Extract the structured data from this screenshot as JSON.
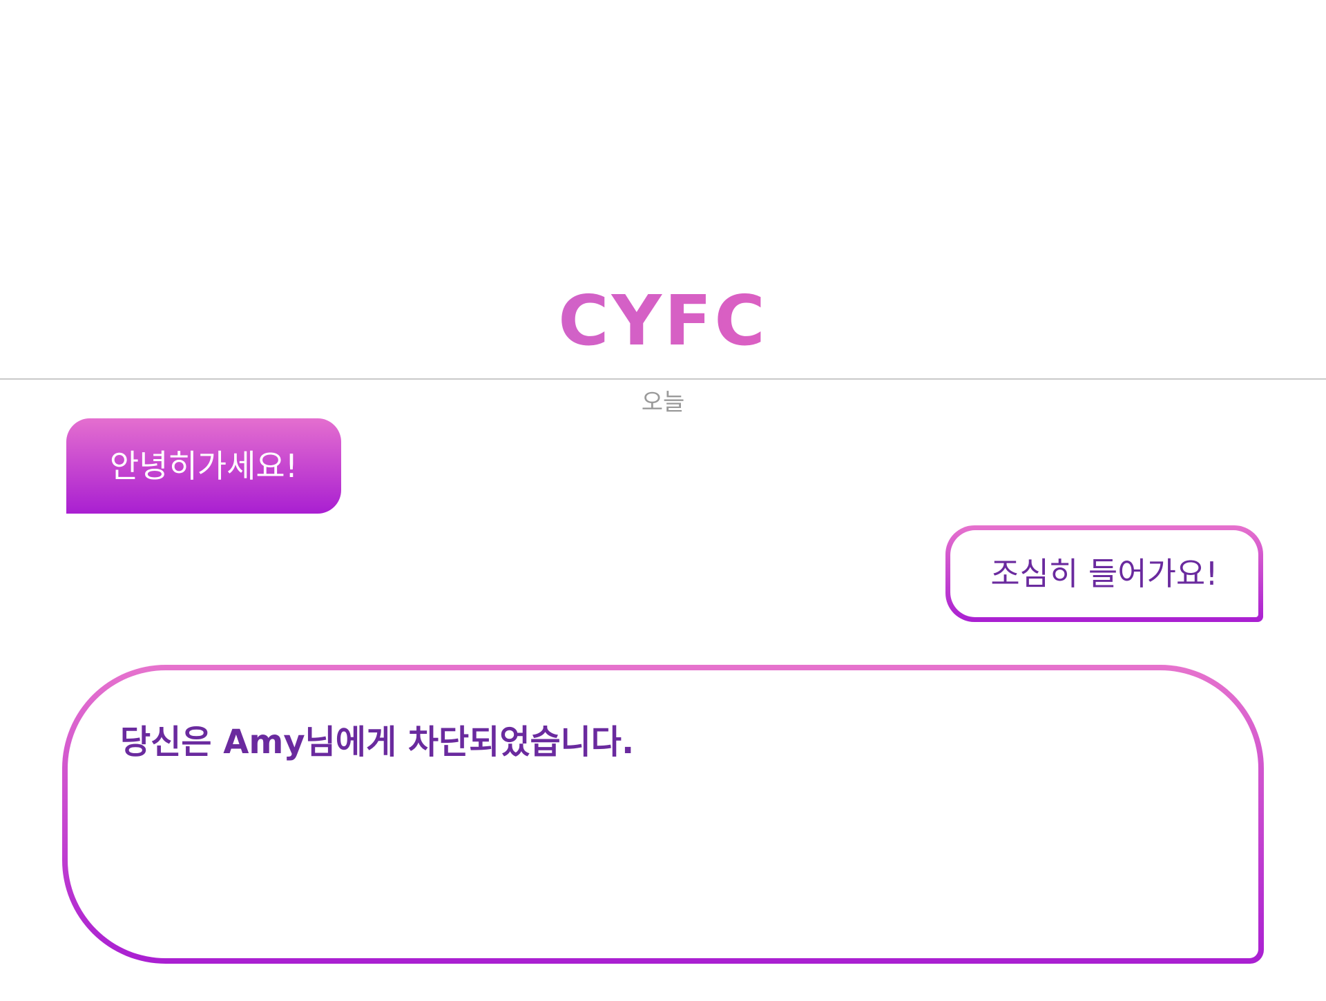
{
  "header": {
    "logo_text": "CYFC"
  },
  "chat": {
    "date_label": "오늘",
    "messages": [
      {
        "side": "received",
        "text": "안녕히가세요!"
      },
      {
        "side": "sent",
        "text": "조심히 들어가요!"
      }
    ]
  },
  "notice": {
    "text": "당신은 Amy님에게 차단되었습니다."
  },
  "colors": {
    "gradient_top": "#e46fcf",
    "gradient_bottom": "#a91fd1",
    "text_purple": "#6a2a9e",
    "date_gray": "#9a9a9a",
    "divider_gray": "#c9c9c9"
  }
}
